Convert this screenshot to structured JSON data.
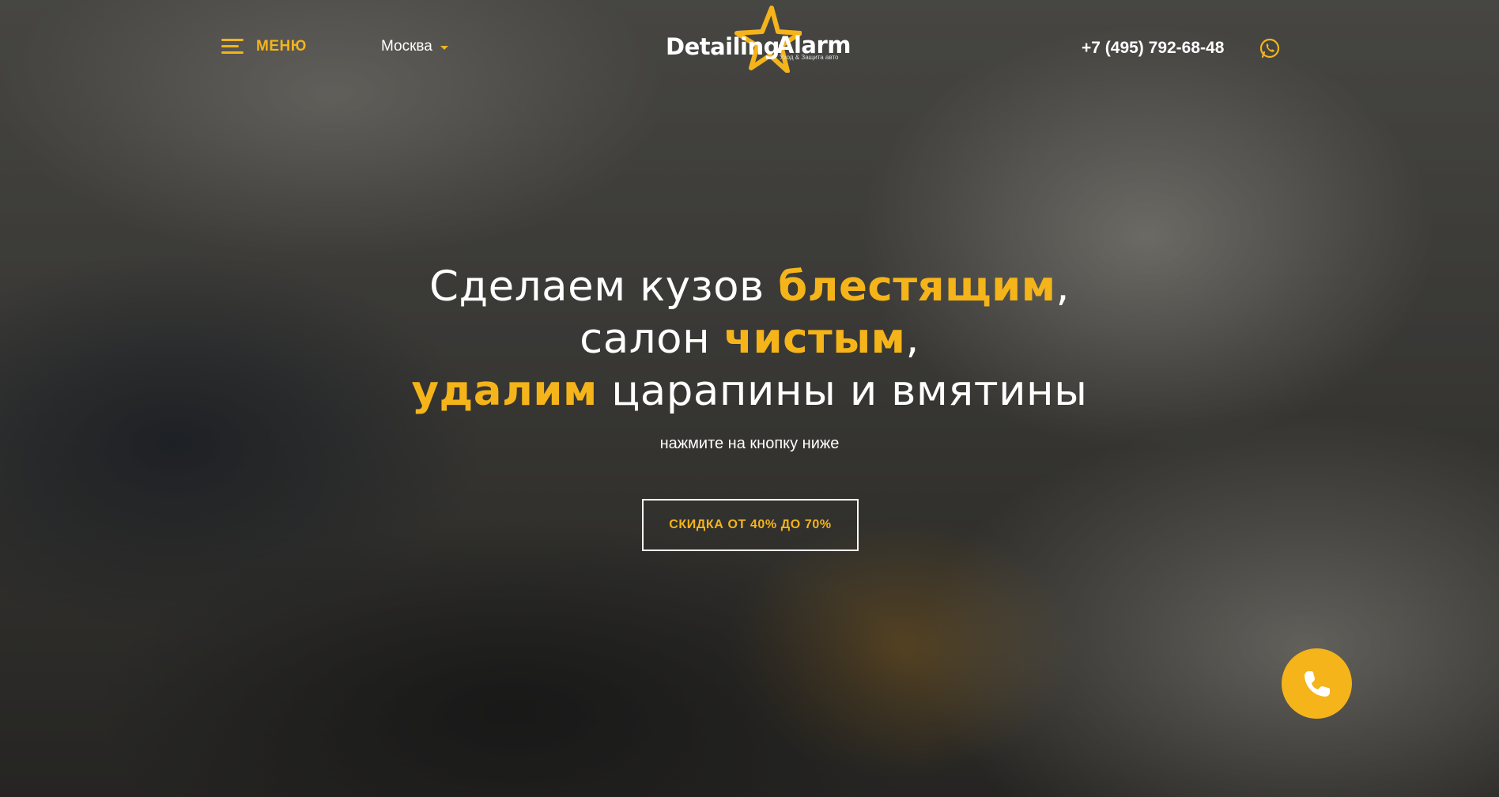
{
  "header": {
    "menu_label": "МЕНЮ",
    "city": "Москва",
    "logo": {
      "word1": "Detailing",
      "word2": "Alarm",
      "tagline": "Уход & Защита авто"
    },
    "phone": "+7 (495) 792-68-48"
  },
  "hero": {
    "line1_plain": "Сделаем кузов ",
    "line1_accent": "блестящим",
    "line1_tail": ",",
    "line2_plain": "салон ",
    "line2_accent": "чистым",
    "line2_tail": ",",
    "line3_accent": "удалим",
    "line3_plain": " царапины и вмятины",
    "subtext": "нажмите на кнопку ниже",
    "cta_label": "СКИДКА ОТ 40% ДО 70%"
  },
  "icons": {
    "menu": "hamburger-icon",
    "caret": "chevron-down-icon",
    "whatsapp": "whatsapp-icon",
    "call": "phone-icon"
  },
  "colors": {
    "accent": "#f4b41a",
    "text": "#ffffff"
  }
}
